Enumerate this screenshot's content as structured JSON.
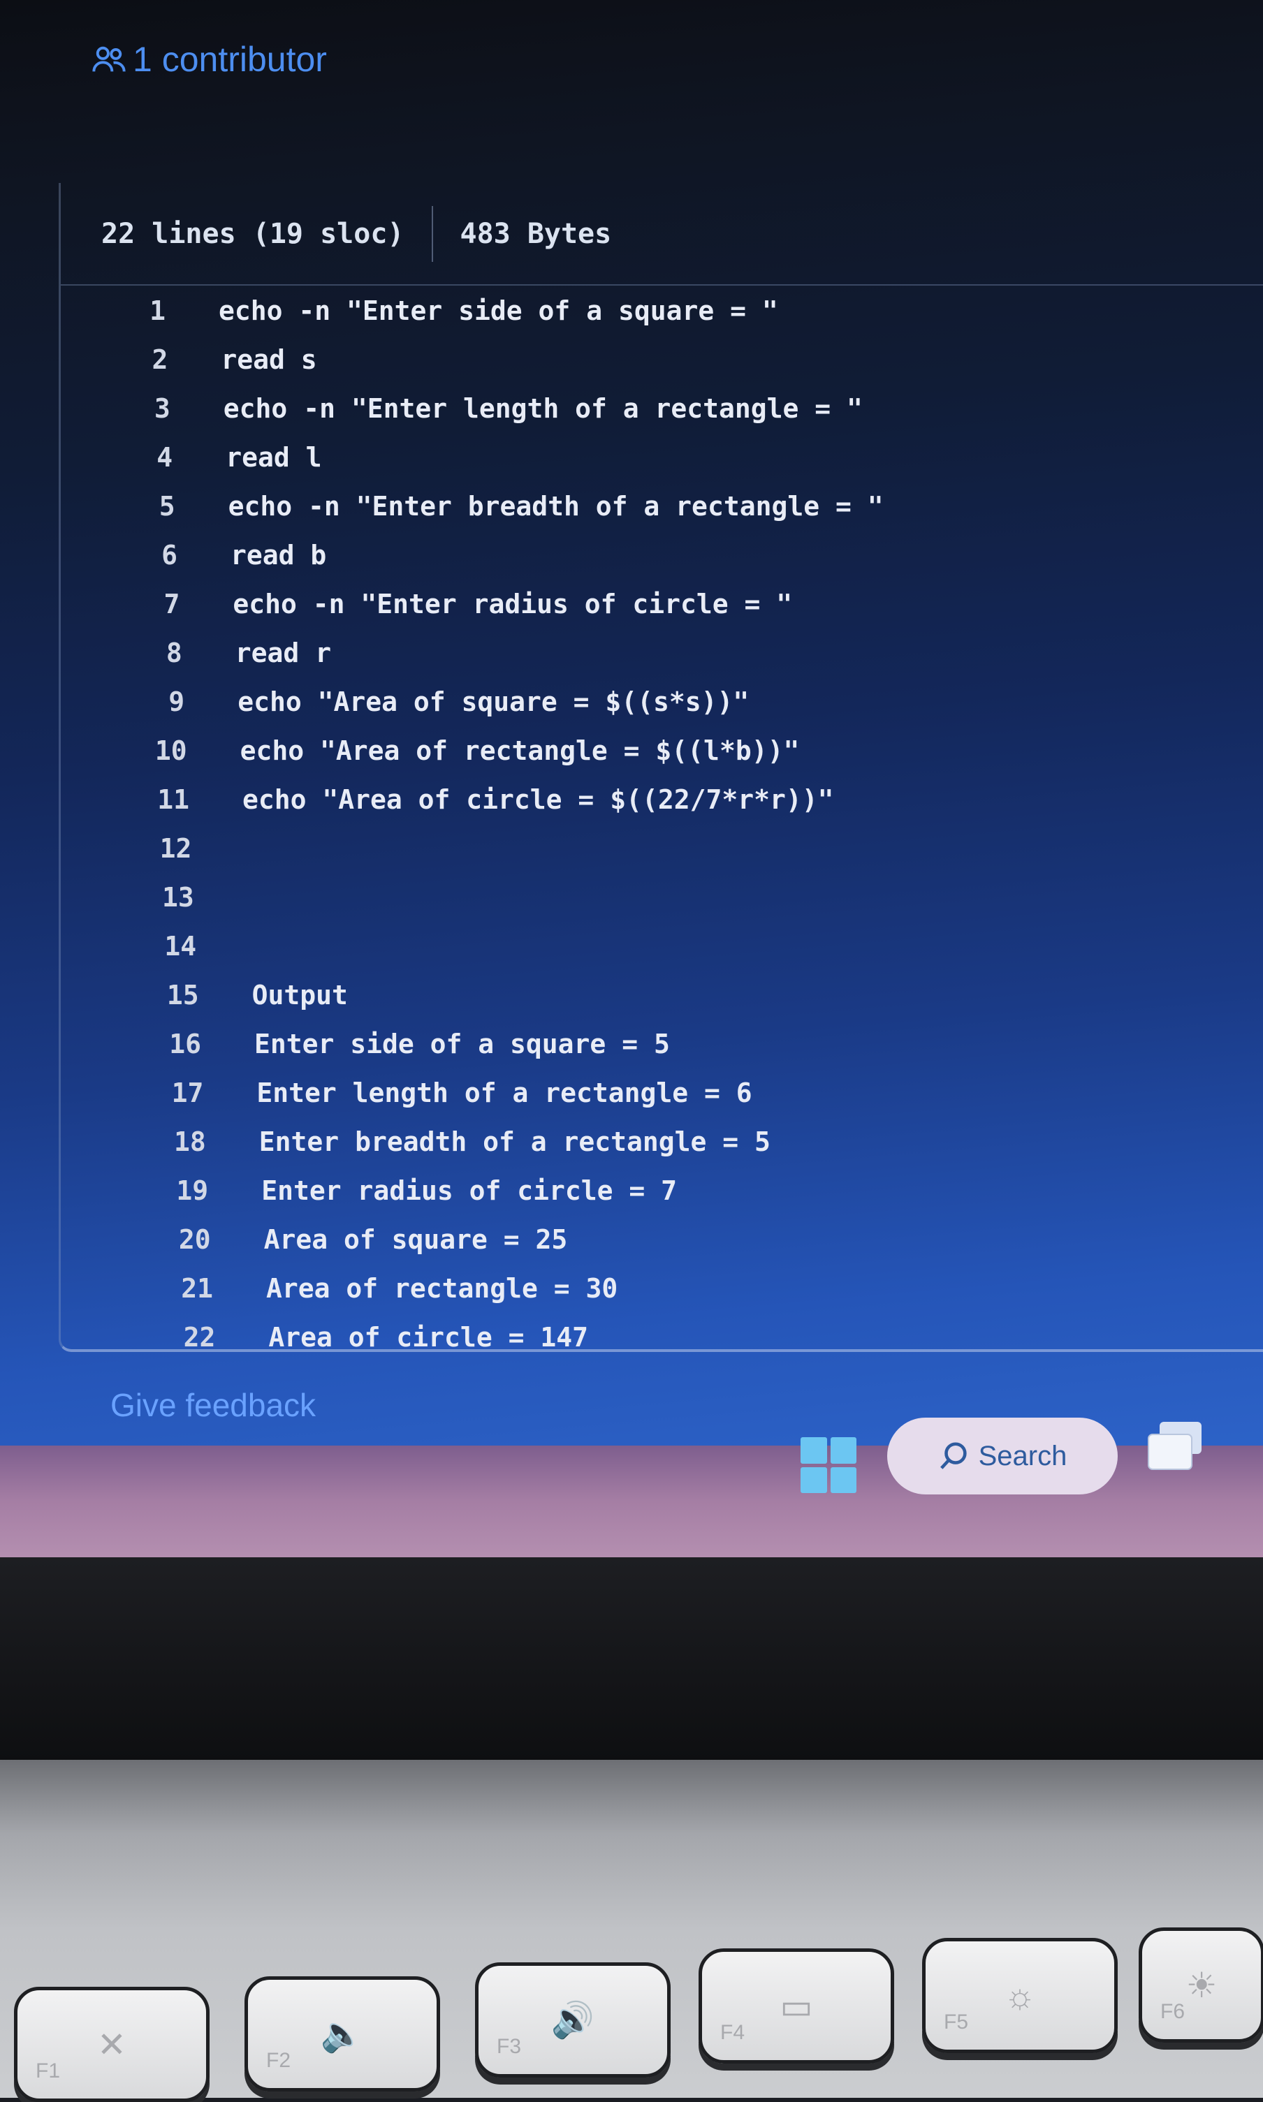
{
  "contributors": {
    "label": "1 contributor",
    "icon": "people-icon"
  },
  "file_info": {
    "lines": "22 lines (19 sloc)",
    "size": "483 Bytes"
  },
  "code_lines": [
    {
      "num": "1",
      "text": "echo -n \"Enter side of a square = \""
    },
    {
      "num": "2",
      "text": "read s"
    },
    {
      "num": "3",
      "text": "echo -n \"Enter length of a rectangle = \""
    },
    {
      "num": "4",
      "text": "read l"
    },
    {
      "num": "5",
      "text": "echo -n \"Enter breadth of a rectangle = \""
    },
    {
      "num": "6",
      "text": "read b"
    },
    {
      "num": "7",
      "text": "echo -n \"Enter radius of circle = \""
    },
    {
      "num": "8",
      "text": "read r"
    },
    {
      "num": "9",
      "text": "echo \"Area of square = $((s*s))\""
    },
    {
      "num": "10",
      "text": "echo \"Area of rectangle = $((l*b))\""
    },
    {
      "num": "11",
      "text": "echo \"Area of circle = $((22/7*r*r))\""
    },
    {
      "num": "12",
      "text": ""
    },
    {
      "num": "13",
      "text": ""
    },
    {
      "num": "14",
      "text": ""
    },
    {
      "num": "15",
      "text": "Output"
    },
    {
      "num": "16",
      "text": "Enter side of a square = 5"
    },
    {
      "num": "17",
      "text": "Enter length of a rectangle = 6"
    },
    {
      "num": "18",
      "text": "Enter breadth of a rectangle = 5"
    },
    {
      "num": "19",
      "text": "Enter radius of circle = 7"
    },
    {
      "num": "20",
      "text": "Area of square = 25"
    },
    {
      "num": "21",
      "text": "Area of rectangle = 30"
    },
    {
      "num": "22",
      "text": "Area of circle = 147"
    }
  ],
  "feedback_label": "Give feedback",
  "taskbar": {
    "start_icon": "windows-start-icon",
    "search_label": "Search",
    "search_icon": "search-icon",
    "task_view_icon": "task-view-icon"
  },
  "function_keys": [
    {
      "label": "F1",
      "icon": "mute-mic-icon"
    },
    {
      "label": "F2",
      "icon": "volume-down-icon"
    },
    {
      "label": "F3",
      "icon": "volume-up-icon"
    },
    {
      "label": "F4",
      "icon": "display-switch-icon"
    },
    {
      "label": "F5",
      "icon": "brightness-down-icon"
    },
    {
      "label": "F6",
      "icon": "brightness-up-icon"
    }
  ],
  "colors": {
    "link_blue": "#4d8ef0",
    "code_text": "#e8ecf6",
    "taskbar": "#a57ea4"
  }
}
